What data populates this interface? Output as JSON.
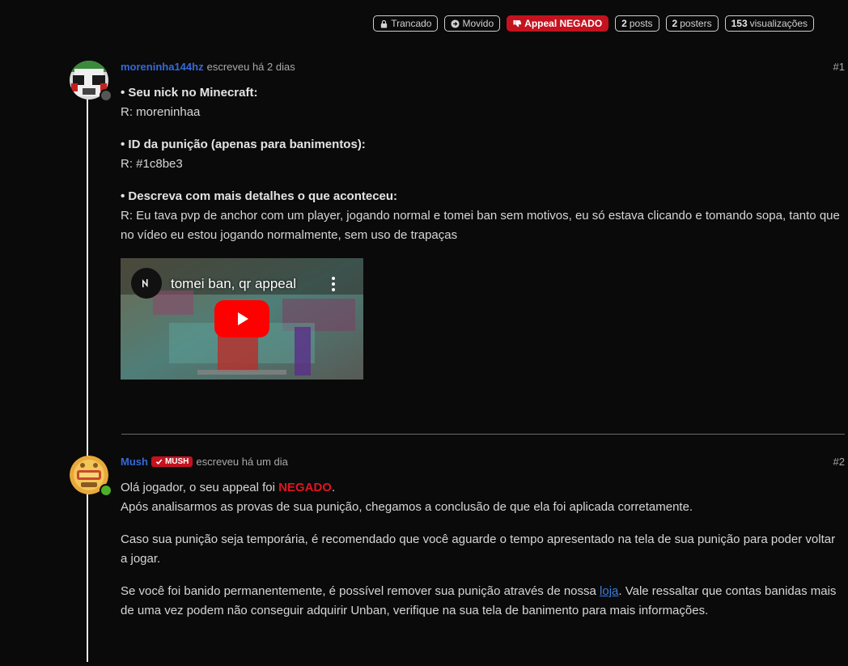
{
  "badges": [
    {
      "label": "Trancado",
      "icon": "lock-icon"
    },
    {
      "label": "Movido",
      "icon": "arrow-right-circle-icon"
    },
    {
      "label": "Appeal NEGADO",
      "icon": "thumbs-down-icon"
    },
    {
      "count": "2",
      "label": "posts"
    },
    {
      "count": "2",
      "label": "posters"
    },
    {
      "count": "153",
      "label": "visualizações"
    }
  ],
  "post1": {
    "username": "moreninha144hz",
    "wrote": "escreveu há 2 dias",
    "number": "#1",
    "q1": "• Seu nick no Minecraft:",
    "a1": "R: moreninhaa",
    "q2": "• ID da punição (apenas para banimentos):",
    "a2": "R: #1c8be3",
    "q3": "• Descreva com mais detalhes o que aconteceu:",
    "a3": "R: Eu tava pvp de anchor com um player, jogando normal e tomei ban sem motivos, eu só estava clicando e tomando sopa, tanto que no vídeo eu estou jogando normalmente, sem uso de trapaças",
    "video_title": "tomei ban, qr appeal",
    "status_color": "#555555"
  },
  "post2": {
    "username": "Mush",
    "tag": "MUSH",
    "wrote": "escreveu há um dia",
    "number": "#2",
    "p1_pre": "Olá jogador, o seu appeal foi ",
    "p1_neg": "NEGADO",
    "p1_post": ".",
    "p1_line2": "Após analisarmos as provas de sua punição, chegamos a conclusão de que ela foi aplicada corretamente.",
    "p2": "Caso sua punição seja temporária, é recomendado que você aguarde o tempo apresentado na tela de sua punição para poder voltar a jogar.",
    "p3_pre": "Se você foi banido permanentemente, é possível remover sua punição através de nossa ",
    "p3_link": "loja",
    "p3_post": ". Vale ressaltar que contas banidas mais de uma vez podem não conseguir adquirir Unban, verifique na sua tela de banimento para mais informações.",
    "status_color": "#4caf2a"
  },
  "colors": {
    "accent_red": "#c4121f",
    "username_blue": "#3569d8",
    "link_blue": "#3b7ddd"
  }
}
